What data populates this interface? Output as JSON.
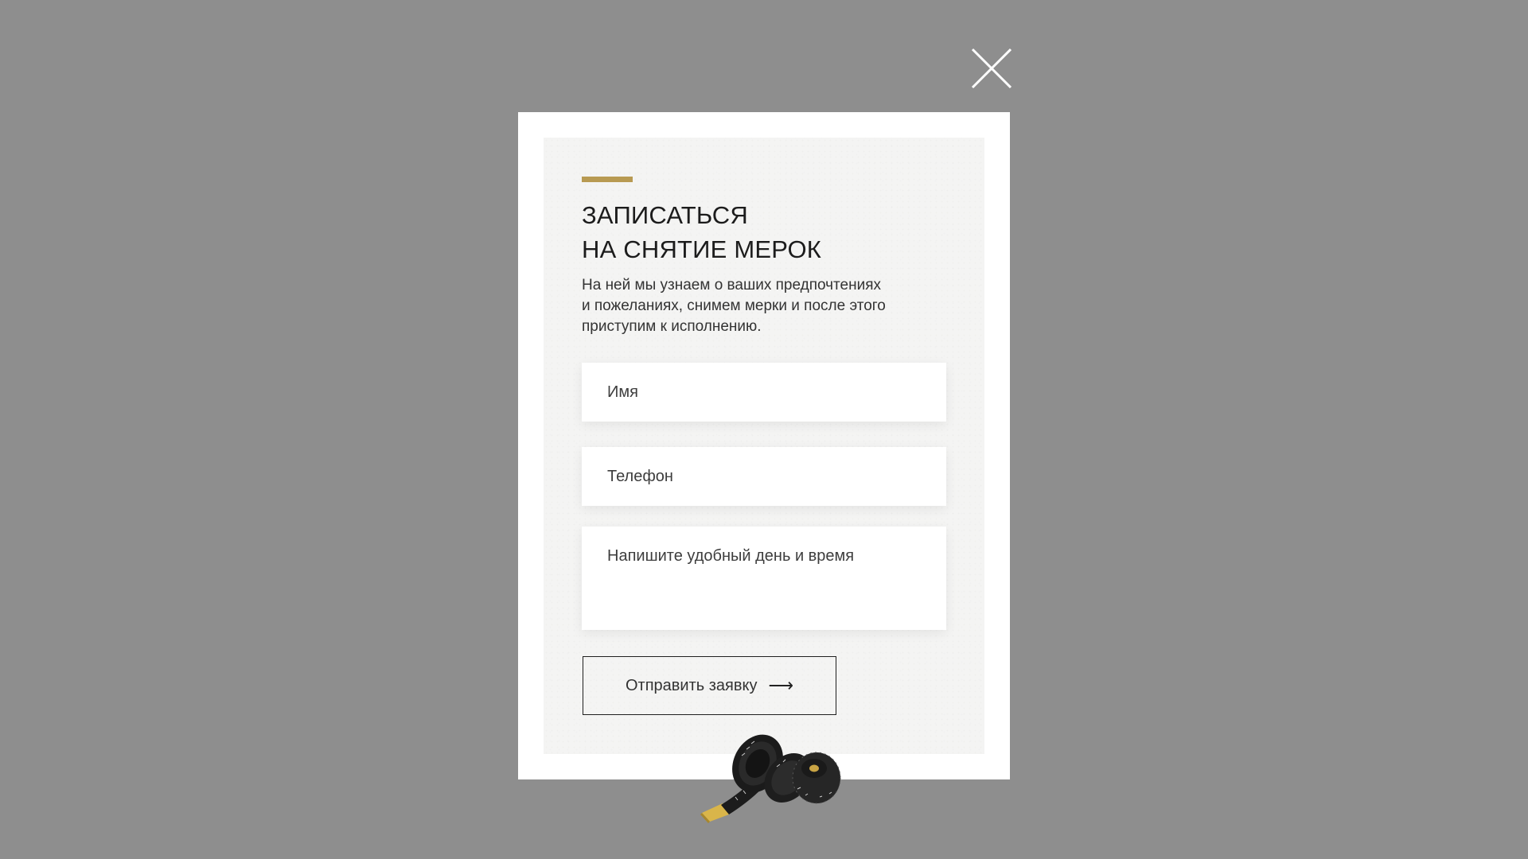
{
  "colors": {
    "overlay": "#8e8e8e",
    "accent": "#b89a52",
    "panel": "#f4f4f3"
  },
  "close_button": {
    "icon": "close-icon"
  },
  "form": {
    "title_line1": "ЗАПИСАТЬСЯ",
    "title_line2": "НА СНЯТИЕ МЕРОК",
    "description_line1": "На ней мы узнаем о ваших предпочтениях",
    "description_line2": "и пожеланиях, снимем мерки и после этого",
    "description_line3": "приступим к исполнению.",
    "name_placeholder": "Имя",
    "phone_placeholder": "Телефон",
    "message_placeholder": "Напишите удобный день и время",
    "submit_label": "Отправить заявку",
    "submit_icon": "arrow-right-icon"
  },
  "decoration": {
    "image": "measuring-tape-image"
  }
}
